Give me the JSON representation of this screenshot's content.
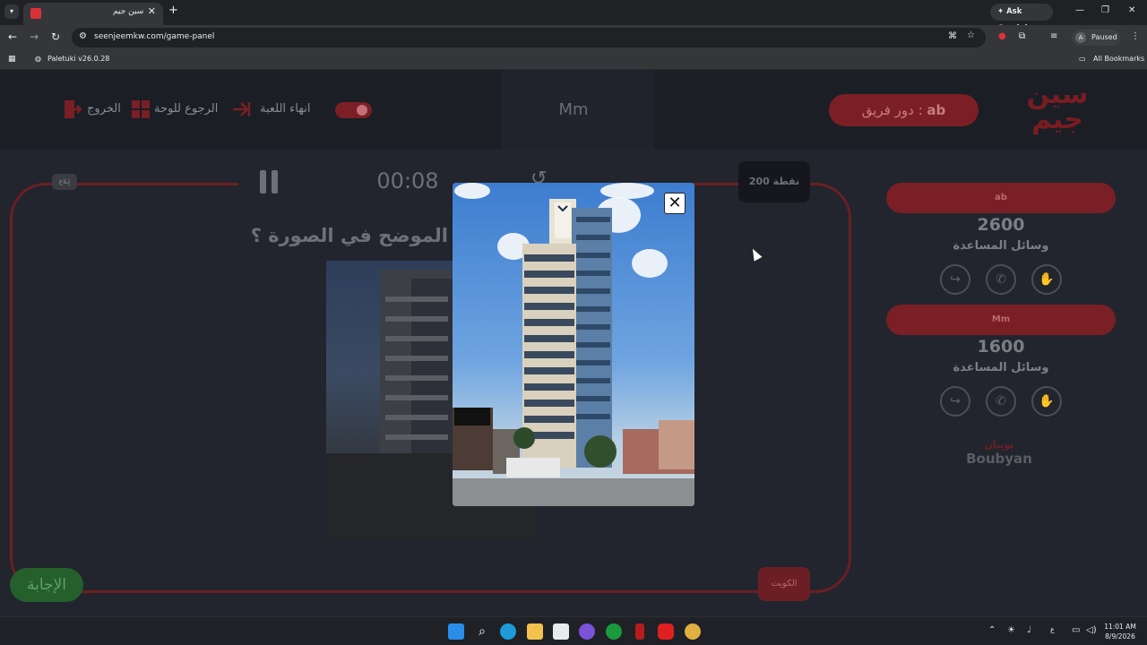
{
  "browser": {
    "tab_title": "سين جيم",
    "url": "seenjeemkw.com/game-panel",
    "ask_gemini": "Ask Gemini",
    "profile_status": "Paused",
    "profile_initial": "A",
    "bookmark_1": "Paletuki v26.0.28",
    "all_bookmarks": "All Bookmarks"
  },
  "header": {
    "logo_text": "سين جيم",
    "team_turn_label": "دور فريق : ",
    "team_turn_name": "ab",
    "center_team": "Mm",
    "end_game": "انهاء اللعبة",
    "back_to_board": "الرجوع للوحة",
    "exit": "الخروج"
  },
  "game": {
    "timer": "00:08",
    "points": "200 نقطة",
    "question": "الموضح في الصورة ؟",
    "answer_button": "الإجابة",
    "country_tag": "الكويت",
    "small_tag": "إبلاغ"
  },
  "teams": [
    {
      "name": "ab",
      "score": "2600",
      "helpers_label": "وسائل المساعدة"
    },
    {
      "name": "Mm",
      "score": "1600",
      "helpers_label": "وسائل المساعدة"
    }
  ],
  "sponsor": {
    "ar": "بوبيان",
    "en": "Boubyan"
  },
  "modal": {
    "close": "✕"
  },
  "clock": {
    "time": "11:01 AM",
    "date": "8/9/2026"
  },
  "colors": {
    "accent_red": "#7a1f25",
    "answer_green": "#245f2c"
  }
}
